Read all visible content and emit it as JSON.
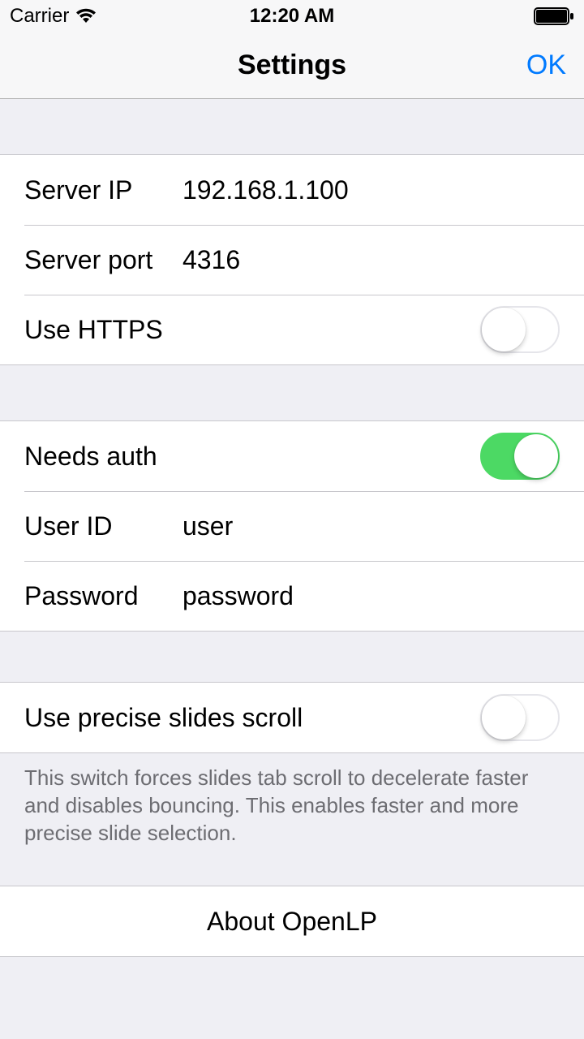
{
  "status": {
    "carrier": "Carrier",
    "time": "12:20 AM"
  },
  "nav": {
    "title": "Settings",
    "ok": "OK"
  },
  "server": {
    "ip_label": "Server IP",
    "ip_value": "192.168.1.100",
    "port_label": "Server port",
    "port_value": "4316",
    "https_label": "Use HTTPS",
    "https_on": false
  },
  "auth": {
    "needs_label": "Needs auth",
    "needs_on": true,
    "user_label": "User ID",
    "user_value": "user",
    "pass_label": "Password",
    "pass_value": "password"
  },
  "scroll": {
    "label": "Use precise slides scroll",
    "on": false,
    "footer": "This switch forces slides tab scroll to decelerate faster and disables bouncing. This enables faster and more precise slide selection."
  },
  "about": {
    "label": "About OpenLP"
  }
}
